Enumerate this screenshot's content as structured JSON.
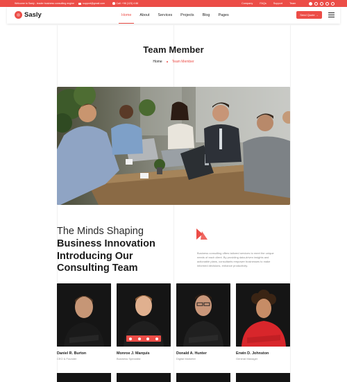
{
  "topbar": {
    "welcome": "Welcome to Sasly - leader business consulting engine",
    "email": "support@gmail.com",
    "phone": "Call: +98 (123) 4 88",
    "links": [
      "Company",
      "FAQs",
      "Support",
      "Team"
    ]
  },
  "header": {
    "logo": "Sasly",
    "nav": [
      "Home",
      "About",
      "Services",
      "Projects",
      "Blog",
      "Pages"
    ],
    "active_nav": "Home",
    "cta": "Send Quote →"
  },
  "page": {
    "title": "Team Member",
    "breadcrumb": [
      "Home",
      "Team Member"
    ]
  },
  "about": {
    "heading_light": "The Minds Shaping",
    "heading_bold": [
      "Business Innovation",
      "Introducing Our",
      "Consulting Team"
    ],
    "text": "Business consulting offers tailored services to meet the unique needs of each client. By providing data-driven insights and actionable plans, consultants empower businesses to make informed decisions, enhance productivity."
  },
  "team": [
    {
      "name": "Daniel R. Burton",
      "role": "CEO & Founder",
      "shirt": "#1a1a1a",
      "face": "#c69676",
      "hair": "#4a3220"
    },
    {
      "name": "Monroe J. Marquis",
      "role": "Business Specialist",
      "shirt": "#1f1f1f",
      "face": "#e0b08f",
      "hair": "#8a5a35"
    },
    {
      "name": "Donald A. Hunter",
      "role": "Digital Marketer",
      "shirt": "#202020",
      "face": "#c9977a",
      "hair": "#2a1c14"
    },
    {
      "name": "Erwin D. Johnston",
      "role": "General Manager",
      "shirt": "#d8262b",
      "face": "#c68c66",
      "hair": "#3a2414"
    }
  ],
  "colors": {
    "accent": "#ec4d47",
    "dark": "#1c1c1c",
    "muted": "#8a8a8a"
  }
}
